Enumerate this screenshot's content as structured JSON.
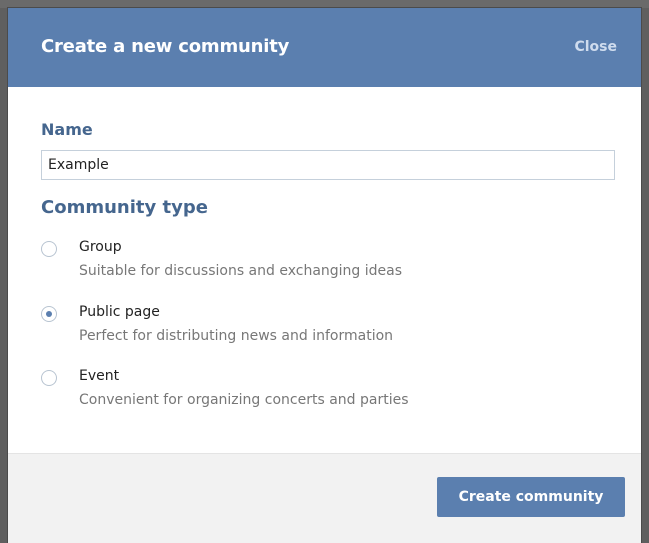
{
  "dialog": {
    "title": "Create a new community",
    "close_label": "Close"
  },
  "form": {
    "name_label": "Name",
    "name_value": "Example",
    "community_type_label": "Community type",
    "options": [
      {
        "title": "Group",
        "description": "Suitable for discussions and exchanging ideas",
        "selected": false
      },
      {
        "title": "Public page",
        "description": "Perfect for distributing news and information",
        "selected": true
      },
      {
        "title": "Event",
        "description": "Convenient for organizing concerts and parties",
        "selected": false
      }
    ]
  },
  "footer": {
    "create_button_label": "Create community"
  },
  "colors": {
    "header_bg": "#5b7faf",
    "label_blue": "#45668e",
    "button_bg": "#5b7faf"
  }
}
